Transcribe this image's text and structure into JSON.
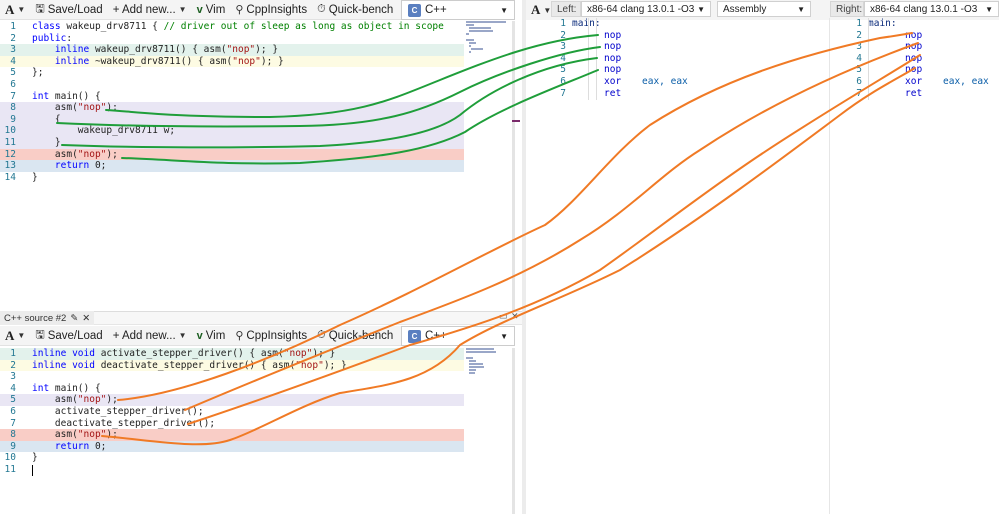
{
  "top_editor": {
    "toolbar": {
      "font_label": "A",
      "save_load": "Save/Load",
      "add_new": "+ Add new...",
      "vim": "Vim",
      "cppinsights": "CppInsights",
      "quickbench": "Quick-bench"
    },
    "language": "C++",
    "lines": [
      {
        "n": "1",
        "text": "class wakeup_drv8711 { // driver out of sleep as long as object in scope"
      },
      {
        "n": "2",
        "text": "public:"
      },
      {
        "n": "3",
        "text": "    inline wakeup_drv8711() { asm(\"nop\"); }"
      },
      {
        "n": "4",
        "text": "    inline ~wakeup_drv8711() { asm(\"nop\"); }"
      },
      {
        "n": "5",
        "text": "};"
      },
      {
        "n": "6",
        "text": ""
      },
      {
        "n": "7",
        "text": "int main() {"
      },
      {
        "n": "8",
        "text": "    asm(\"nop\");"
      },
      {
        "n": "9",
        "text": "    {"
      },
      {
        "n": "10",
        "text": "        wakeup_drv8711 w;"
      },
      {
        "n": "11",
        "text": "    }"
      },
      {
        "n": "12",
        "text": "    asm(\"nop\");"
      },
      {
        "n": "13",
        "text": "    return 0;"
      },
      {
        "n": "14",
        "text": "}"
      }
    ]
  },
  "bottom_editor": {
    "tab_title": "C++ source #2",
    "toolbar": {
      "font_label": "A",
      "save_load": "Save/Load",
      "add_new": "+ Add new...",
      "vim": "Vim",
      "cppinsights": "CppInsights",
      "quickbench": "Quick-bench"
    },
    "language": "C++",
    "lines": [
      {
        "n": "1",
        "text": "inline void activate_stepper_driver() { asm(\"nop\"); }"
      },
      {
        "n": "2",
        "text": "inline void deactivate_stepper_driver() { asm(\"nop\"); }"
      },
      {
        "n": "3",
        "text": ""
      },
      {
        "n": "4",
        "text": "int main() {"
      },
      {
        "n": "5",
        "text": "    asm(\"nop\");"
      },
      {
        "n": "6",
        "text": "    activate_stepper_driver();"
      },
      {
        "n": "7",
        "text": "    deactivate_stepper_driver();"
      },
      {
        "n": "8",
        "text": "    asm(\"nop\");"
      },
      {
        "n": "9",
        "text": "    return 0;"
      },
      {
        "n": "10",
        "text": "}"
      },
      {
        "n": "11",
        "text": ""
      }
    ]
  },
  "diff_view": {
    "font_label": "A",
    "left_label": "Left:",
    "left_compiler": "x86-64 clang 13.0.1 -O3",
    "left_view": "Assembly",
    "right_label": "Right:",
    "right_compiler": "x86-64 clang 13.0.1 -O3",
    "left_asm": [
      {
        "n": "1",
        "label": "main:",
        "op": "",
        "args": ""
      },
      {
        "n": "2",
        "label": "",
        "op": "nop",
        "args": ""
      },
      {
        "n": "3",
        "label": "",
        "op": "nop",
        "args": ""
      },
      {
        "n": "4",
        "label": "",
        "op": "nop",
        "args": ""
      },
      {
        "n": "5",
        "label": "",
        "op": "nop",
        "args": ""
      },
      {
        "n": "6",
        "label": "",
        "op": "xor",
        "args": "eax, eax"
      },
      {
        "n": "7",
        "label": "",
        "op": "ret",
        "args": ""
      }
    ],
    "right_asm": [
      {
        "n": "1",
        "label": "main:",
        "op": "",
        "args": ""
      },
      {
        "n": "2",
        "label": "",
        "op": "nop",
        "args": ""
      },
      {
        "n": "3",
        "label": "",
        "op": "nop",
        "args": ""
      },
      {
        "n": "4",
        "label": "",
        "op": "nop",
        "args": ""
      },
      {
        "n": "5",
        "label": "",
        "op": "nop",
        "args": ""
      },
      {
        "n": "6",
        "label": "",
        "op": "xor",
        "args": "eax, eax"
      },
      {
        "n": "7",
        "label": "",
        "op": "ret",
        "args": ""
      }
    ]
  },
  "annotation_colors": {
    "green": "#1f9e3a",
    "orange": "#f07a25"
  }
}
